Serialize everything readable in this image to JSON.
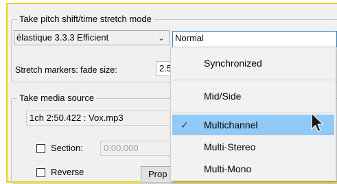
{
  "pitch_group": {
    "title": "Take pitch shift/time stretch mode",
    "algorithm_value": "élastique 3.3.3 Efficient",
    "mode_value": "Normal",
    "stretch_markers_label": "Stretch markers: fade size:",
    "fade_size_value": "2.5"
  },
  "media_group": {
    "title": "Take media source",
    "source_value": "1ch 2:50.422 : Vox.mp3",
    "section_label": "Section:",
    "section_start_value": "0:00.000",
    "reverse_label": "Reverse",
    "properties_button": "Prop"
  },
  "dropdown": {
    "items": [
      {
        "label": "Synchronized",
        "checked": false
      },
      {
        "label": "Mid/Side",
        "checked": false
      },
      {
        "label": "Multichannel",
        "checked": true
      },
      {
        "label": "Multi-Stereo",
        "checked": false
      },
      {
        "label": "Multi-Mono",
        "checked": false
      }
    ],
    "check_glyph": "✓"
  },
  "colors": {
    "frame_border": "#e8d300",
    "hover_highlight": "#91c9f7",
    "dialog_bg": "#f0f0f0"
  }
}
